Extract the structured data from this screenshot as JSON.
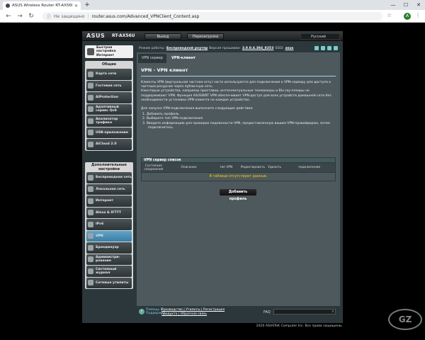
{
  "browser": {
    "tab_title": "ASUS Wireless Router RT-AX56U",
    "not_secure": "Не защищено",
    "url": "router.asus.com/Advanced_VPNClient_Content.asp",
    "avatar_letter": "A"
  },
  "header": {
    "logo": "ASUS",
    "model": "RT-AX56U",
    "logout": "Выход",
    "reboot": "Перезагрузка",
    "language": "Русский"
  },
  "status": {
    "mode_label": "Режим работы:",
    "mode_value": "Беспроводной роутер",
    "fw_label": "Версия прошивки:",
    "fw_value": "3.0.0.4.384_8253",
    "ssid_label": "SSID:",
    "ssid_value": "asus"
  },
  "sidebar": {
    "quick_setup": "Быстрая настройка Интернет",
    "general_title": "Общие",
    "general_items": [
      "Карта сети",
      "Гостевая сеть",
      "AiProtection",
      "Адаптивный сервис QoS",
      "Анализатор трафика",
      "USB-приложение",
      "AiCloud 2.0"
    ],
    "advanced_title": "Дополнительные настройки",
    "advanced_items": [
      "Беспроводная сеть",
      "Локальная сеть",
      "Интернет",
      "Alexa & IFTTT",
      "IPv6",
      "VPN",
      "Брандмауэр",
      "Администри-рование",
      "Системный журнал",
      "Сетевые утилиты"
    ],
    "active_item": "VPN"
  },
  "tabs": [
    "VPN сервер",
    "VPN-клиент"
  ],
  "active_tab": "VPN-клиент",
  "panel": {
    "title": "VPN - VPN клиент",
    "para1": "Клиенты VPN (виртуальная частная сеть) часто используются для подключения к VPN-серверу для доступа к частным ресурсам через публичную сеть.",
    "para2": "Некоторые устройства, например приставки, интеллектуальные телевизоры и Blu-ray-плееры не поддерживают VPN. Функция ASUSWRT VPN обеспечивает VPN-доступ для всех устройств домашней сети без необходимости установки VPN-клиента на каждое устройство.",
    "steps_intro": "Для запуска VPN-подключения выполните следующие действия:",
    "steps": [
      "1. Добавить профиль",
      "2. Выберите тип VPN-подключения",
      "3. Введите информацию для проверки подлинности VPN, предоставленную вашим VPN-провайдером, затем подключитесь."
    ],
    "table_title": "VPN сервер список",
    "columns": [
      "Состояние соединения",
      "Описание",
      "тип VPN",
      "Редактировать",
      "Удалить",
      "подключение"
    ],
    "empty_message": "В таблице отсутствуют данные.",
    "add_profile": "Добавить профиль"
  },
  "footer": {
    "help_line1": "Помощь &",
    "help_line2": "Поддержка",
    "links_line1": "Руководство | Утилиты | Регистрация",
    "links_line2": "продукта | Обратная связь",
    "faq": "FAQ",
    "copyright": "2020 ASUSTeK Computer Inc. Все права защищены."
  },
  "watermark": "GZ"
}
